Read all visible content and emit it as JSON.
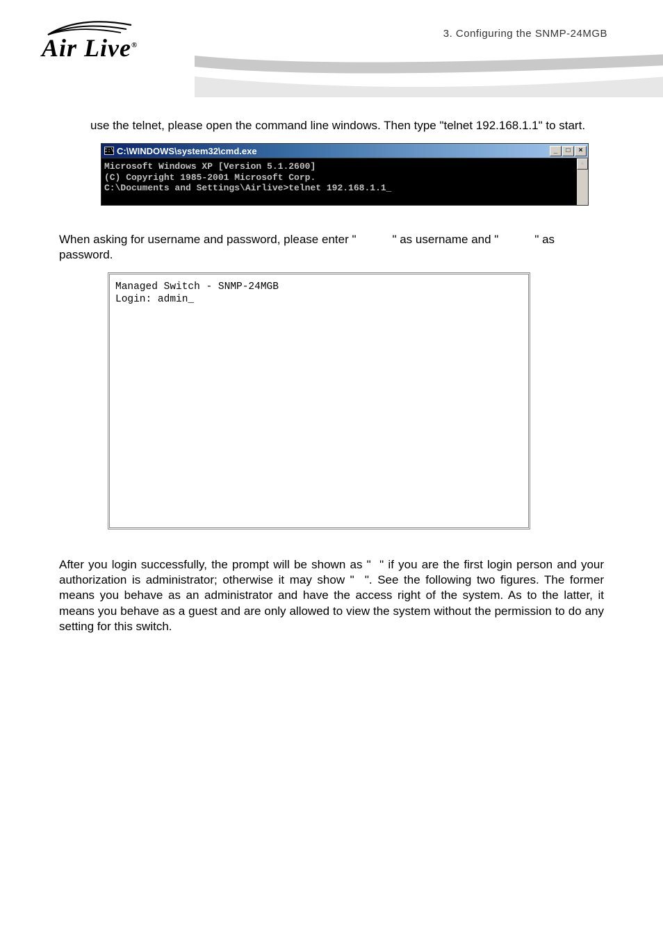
{
  "header": {
    "logo_text": "Air Live",
    "breadcrumb": "3.  Configuring  the  SNMP-24MGB"
  },
  "intro_text": "use the telnet, please open the command line windows. Then type \"telnet 192.168.1.1\" to start.",
  "cmd": {
    "title": "C:\\WINDOWS\\system32\\cmd.exe",
    "icon_text": "C:\\",
    "min": "_",
    "max": "□",
    "close": "×",
    "lines": [
      "Microsoft Windows XP [Version 5.1.2600]",
      "(C) Copyright 1985-2001 Microsoft Corp.",
      "",
      "C:\\Documents and Settings\\Airlive>telnet 192.168.1.1_"
    ],
    "scroll_up": "▲"
  },
  "midpara_parts": {
    "p1": "When asking for username and password, please enter \"",
    "p2": "\" as username and \"",
    "p3": "\" as password."
  },
  "telnet": {
    "lines": [
      "Managed Switch - SNMP-24MGB",
      "Login: admin_"
    ]
  },
  "lastpara_parts": {
    "p1": "After you login successfully, the prompt will be shown as \"",
    "p2": "\" if you are the first login person and your authorization is administrator; otherwise it may show \"",
    "p3": "\". See the following two figures. The former means you behave as an administrator and have the access right of the system. As to the latter, it means you behave as a guest and are only allowed to view the system without the permission to do any setting for this switch."
  }
}
